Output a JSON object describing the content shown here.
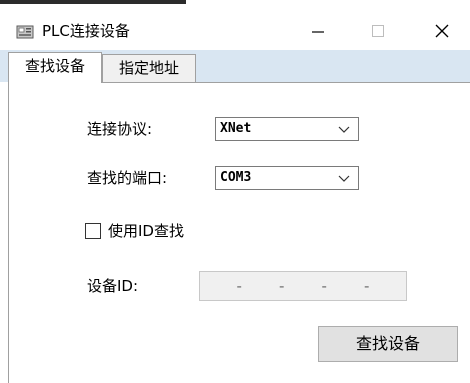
{
  "window": {
    "title": "PLC连接设备",
    "minimize_glyph": "—",
    "maximize_glyph": "☐",
    "close_glyph": "✕"
  },
  "tabs": [
    {
      "label": "查找设备",
      "active": true
    },
    {
      "label": "指定地址",
      "active": false
    }
  ],
  "form": {
    "protocol_label": "连接协议:",
    "protocol_value": "XNet",
    "port_label": "查找的端口:",
    "port_value": "COM3",
    "use_id_label": "使用ID查找",
    "use_id_checked": false,
    "device_id_label": "设备ID:",
    "device_id_segments": [
      "-",
      "-",
      "-",
      "-"
    ],
    "find_button_label": "查找设备"
  },
  "colors": {
    "tabstrip_bg": "#d9e6f2",
    "button_bg": "#e1e1e1",
    "disabled_field_bg": "#f0f0f0"
  },
  "icons": {
    "app": "plc-device-icon",
    "dropdown": "chevron-down-icon"
  }
}
